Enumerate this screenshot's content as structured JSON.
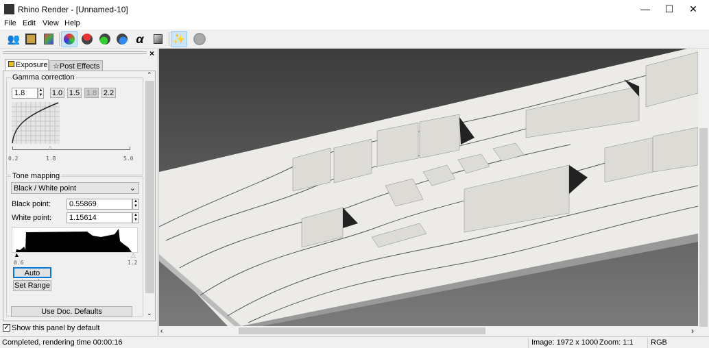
{
  "window": {
    "title": "Rhino Render - [Unnamed-10]",
    "minimize": "—",
    "maximize": "☐",
    "close": "✕"
  },
  "menu": [
    "File",
    "Edit",
    "View",
    "Help"
  ],
  "toolbar": {
    "icons": [
      "people-icon",
      "save-icon",
      "copy-image-icon",
      "rgb-channels-icon",
      "red-channel-icon",
      "green-channel-icon",
      "blue-channel-icon",
      "alpha-channel-icon",
      "cube-icon",
      "wand-icon",
      "stop-icon"
    ],
    "alpha_glyph": "α"
  },
  "panel": {
    "close": "×",
    "tabs": [
      "Exposure",
      "Post Effects"
    ],
    "gamma": {
      "label": "Gamma correction",
      "value": "1.8",
      "presets": [
        "1.0",
        "1.5",
        "1.8",
        "2.2"
      ],
      "slider_min": "0.2",
      "slider_value_label": "1.8",
      "slider_max": "5.0",
      "slider_fraction": 0.333
    },
    "tone": {
      "label": "Tone mapping",
      "method": "Black / White point",
      "black_label": "Black point:",
      "black_value": "0.55869",
      "white_label": "White point:",
      "white_value": "1.15614",
      "hist_min": "0.6",
      "hist_max": "1.2",
      "auto_levels": "Auto Levels",
      "set_range": "Set Range",
      "use_defaults": "Use Doc. Defaults"
    },
    "show_default": "Show this panel by default",
    "show_default_checked": true
  },
  "status": {
    "message": "Completed, rendering time 00:00:16",
    "image": "Image: 1972 x 1000",
    "zoom": "Zoom: 1:1",
    "mode": "RGB"
  }
}
